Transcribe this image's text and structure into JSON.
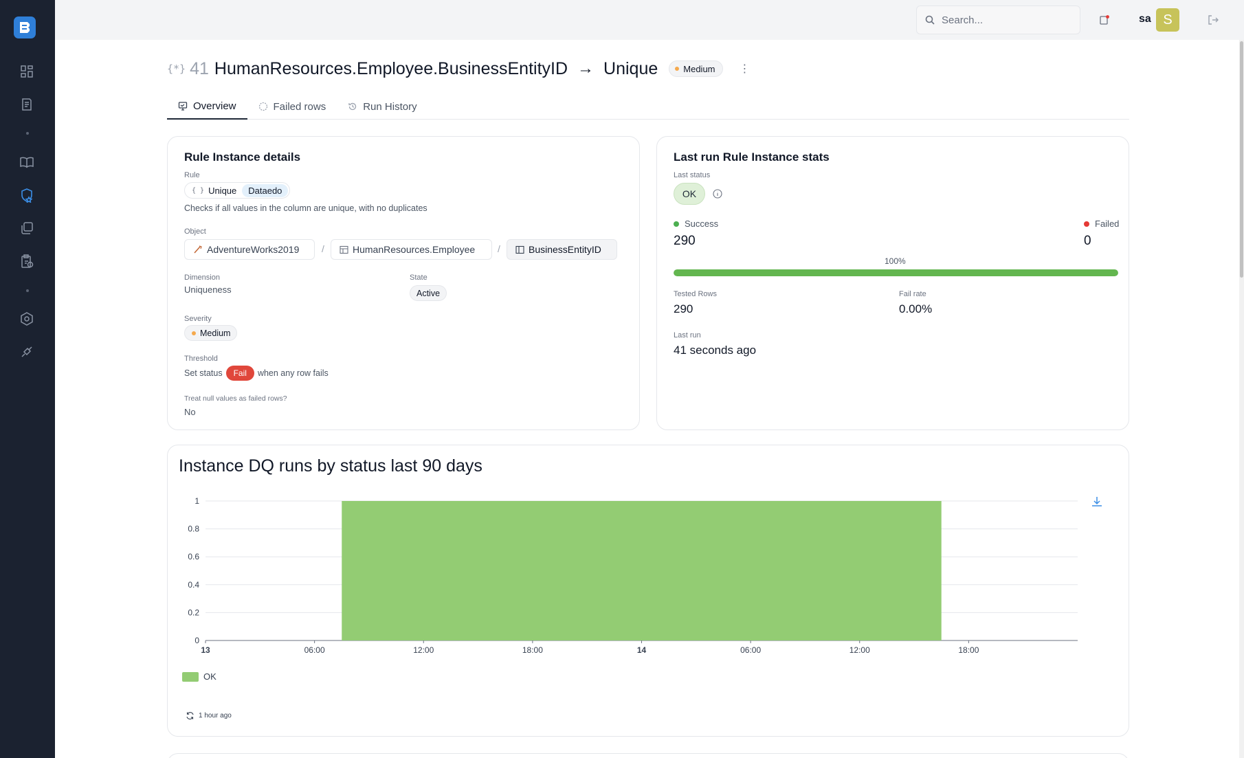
{
  "search": {
    "placeholder": "Search..."
  },
  "user": {
    "name": "sa",
    "avatar_letter": "S"
  },
  "header": {
    "icon_text": "{*}",
    "id": "41",
    "title": "HumanResources.Employee.BusinessEntityID",
    "arrow": "→",
    "type": "Unique",
    "severity_badge": "Medium"
  },
  "tabs": [
    {
      "label": "Overview"
    },
    {
      "label": "Failed rows"
    },
    {
      "label": "Run History"
    }
  ],
  "details": {
    "title": "Rule Instance details",
    "rule_label": "Rule",
    "rule_icon": "{ }",
    "rule_name": "Unique",
    "rule_source": "Dataedo",
    "rule_description": "Checks if all values in the column are unique, with no duplicates",
    "object_label": "Object",
    "object_path": [
      "AdventureWorks2019",
      "HumanResources.Employee",
      "BusinessEntityID"
    ],
    "path_separator": "/",
    "dimension_label": "Dimension",
    "dimension": "Uniqueness",
    "state_label": "State",
    "state": "Active",
    "severity_label": "Severity",
    "severity": "Medium",
    "threshold_label": "Threshold",
    "threshold_prefix": "Set status",
    "threshold_status": "Fail",
    "threshold_suffix": "when any row fails",
    "null_label": "Treat null values as failed rows?",
    "null_value": "No"
  },
  "stats": {
    "title": "Last run Rule Instance stats",
    "last_status_label": "Last status",
    "last_status": "OK",
    "success_label": "Success",
    "success_value": "290",
    "failed_label": "Failed",
    "failed_value": "0",
    "success_percent_text": "100%",
    "success_fraction": 1.0,
    "tested_rows_label": "Tested Rows",
    "tested_rows": "290",
    "fail_rate_label": "Fail rate",
    "fail_rate": "0.00%",
    "last_run_label": "Last run",
    "last_run": "41 seconds ago"
  },
  "chart_section": {
    "title": "Instance DQ runs by status last 90 days",
    "refreshed": "1 hour ago"
  },
  "colors": {
    "ok_green": "#93cc73",
    "progress_green": "#63b64f",
    "fail_red": "#e53935",
    "accent_blue": "#2f7fd8"
  },
  "chart_data": {
    "type": "area",
    "title": "Instance DQ runs by status last 90 days",
    "xlabel": "",
    "ylabel": "",
    "ylim": [
      0,
      1
    ],
    "y_ticks": [
      "0",
      "0.2",
      "0.4",
      "0.6",
      "0.8",
      "1"
    ],
    "x_ticks": [
      "13",
      "06:00",
      "12:00",
      "18:00",
      "14",
      "06:00",
      "12:00",
      "18:00"
    ],
    "x_range_hours": [
      0,
      48
    ],
    "series": [
      {
        "name": "OK",
        "color": "#93cc73",
        "x_start_hours": 7.5,
        "x_end_hours": 40.5,
        "value": 1
      }
    ],
    "legend": "bottom-left",
    "grid": true
  }
}
